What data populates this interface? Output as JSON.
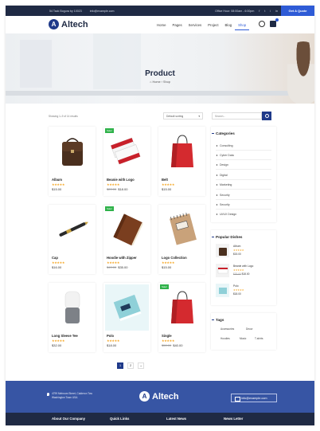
{
  "topbar": {
    "address": "54 Tack Bogura by 10023",
    "email": "info@example.com",
    "hours": "Office Hour: 08:00am - 6:00pm",
    "social": [
      "f",
      "t",
      "i",
      "in"
    ],
    "quote_button": "Get A Quote"
  },
  "header": {
    "logo_letter": "A",
    "logo_text": "Altech",
    "nav": [
      "Home",
      "Pages",
      "Services",
      "Project",
      "Blog",
      "Shop"
    ],
    "active_nav": "Shop",
    "cart_count": "0"
  },
  "hero": {
    "title": "Product",
    "breadcrumb_home": "Home",
    "breadcrumb_current": "Shop"
  },
  "toolbar": {
    "result_count": "Showing 1–9 of 14 results",
    "sort_value": "Default sorting",
    "search_placeholder": "Search..."
  },
  "products": [
    {
      "name": "Album",
      "rating": 5,
      "price": "$15.00",
      "old_price": "",
      "sale": false,
      "icon": "briefcase"
    },
    {
      "name": "Beanie with Logo",
      "rating": 5,
      "price": "$18.00",
      "old_price": "$20.00",
      "sale": true,
      "icon": "business-cards"
    },
    {
      "name": "Belt",
      "rating": 5,
      "price": "$15.00",
      "old_price": "",
      "sale": false,
      "icon": "shopping-bag"
    },
    {
      "name": "Cap",
      "rating": 5,
      "price": "$16.00",
      "old_price": "",
      "sale": false,
      "icon": "pen"
    },
    {
      "name": "Hoodie with Zipper",
      "rating": 5,
      "price": "$35.00",
      "old_price": "$40.00",
      "sale": true,
      "icon": "notebook"
    },
    {
      "name": "Logo Collection",
      "rating": 5,
      "price": "$15.00",
      "old_price": "",
      "sale": false,
      "icon": "spiral-notebook"
    },
    {
      "name": "Long Sleeve Tee",
      "rating": 5,
      "price": "$32.00",
      "old_price": "",
      "sale": false,
      "icon": "smart-speaker"
    },
    {
      "name": "Polo",
      "rating": 5,
      "price": "$18.00",
      "old_price": "",
      "sale": false,
      "icon": "book"
    },
    {
      "name": "Single",
      "rating": 5,
      "price": "$40.00",
      "old_price": "$50.00",
      "sale": true,
      "icon": "shopping-bag"
    }
  ],
  "sale_label": "Sale!",
  "sidebar": {
    "categories_title": "Categories",
    "categories": [
      "Consulting",
      "Cyber Data",
      "Design",
      "Digital",
      "Marketing",
      "Security",
      "Security",
      "UI/UX Design"
    ],
    "popular_title": "Popular Dishes",
    "popular": [
      {
        "name": "Album",
        "rating": 5,
        "price": "$15.00",
        "old_price": ""
      },
      {
        "name": "Beanie with Logo",
        "rating": 5,
        "price": "$18.00",
        "old_price": "$20.00"
      },
      {
        "name": "Polo",
        "rating": 5,
        "price": "$18.00",
        "old_price": ""
      }
    ],
    "tags_title": "Tags",
    "tags": [
      "Accessories",
      "Decor",
      "Hoodies",
      "Music",
      "T-shirts"
    ]
  },
  "pagination": [
    "1",
    "2",
    "→"
  ],
  "footer": {
    "address": "4799 Mehnom Street, Calderon Tow Washington Town USA",
    "logo_letter": "A",
    "logo_text": "Altech",
    "email": "info@example.com",
    "columns": [
      "About Our Company",
      "Quick Links",
      "Latest News",
      "News Letter"
    ]
  }
}
